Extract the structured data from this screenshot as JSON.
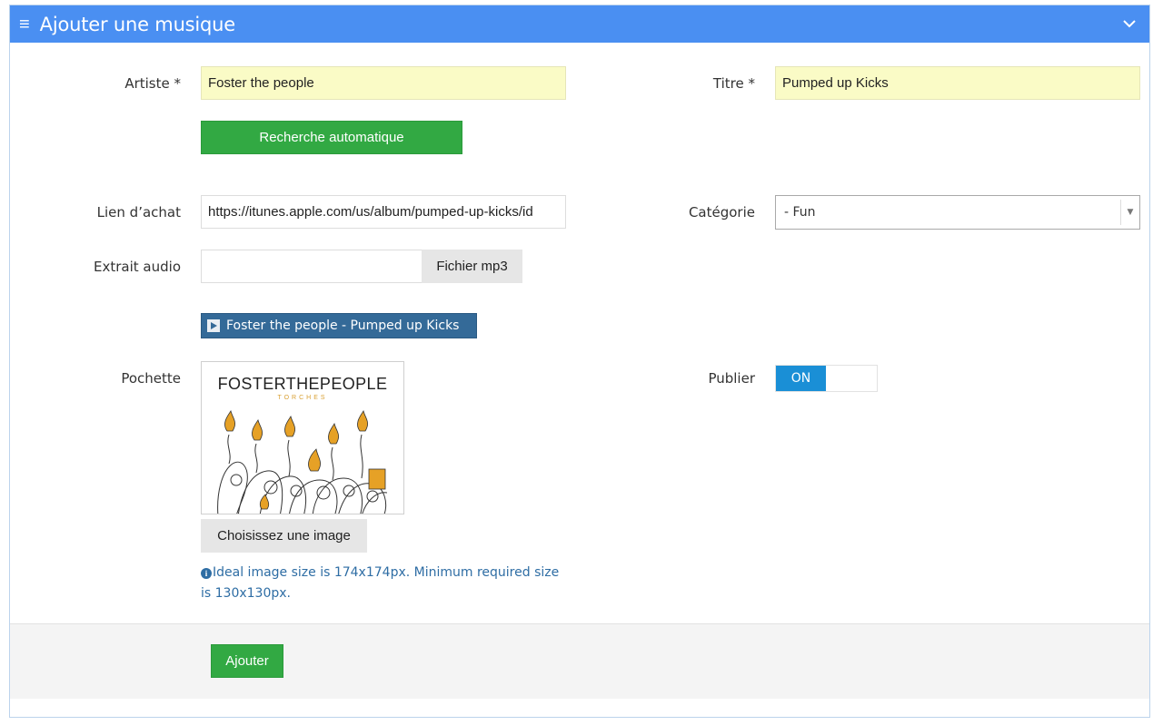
{
  "header": {
    "title": "Ajouter une musique",
    "menu_glyph": "≡"
  },
  "form": {
    "artist": {
      "label": "Artiste *",
      "value": "Foster the people"
    },
    "title": {
      "label": "Titre *",
      "value": "Pumped up Kicks"
    },
    "auto_search": {
      "label": "Recherche automatique"
    },
    "purchase_link": {
      "label": "Lien d’achat",
      "value": "https://itunes.apple.com/us/album/pumped-up-kicks/id"
    },
    "category": {
      "label": "Catégorie",
      "selected": "- Fun"
    },
    "audio": {
      "label": "Extrait audio",
      "value": "",
      "button": "Fichier mp3",
      "track": "Foster the people - Pumped up Kicks"
    },
    "cover": {
      "label": "Pochette",
      "band_text": "FOSTERTHEPEOPLE",
      "album_text": "TORCHES",
      "button": "Choisissez une image",
      "help": "Ideal image size is 174x174px. Minimum required size is 130x130px."
    },
    "publish": {
      "label": "Publier",
      "state": "ON"
    }
  },
  "footer": {
    "submit": "Ajouter"
  },
  "colors": {
    "header": "#4a8ff2",
    "green": "#32a943",
    "required_bg": "#fafbc6",
    "toggle_on": "#1a8fd6",
    "audio_chip": "#346a98"
  },
  "icons": {
    "menu": "hamburger-icon",
    "collapse": "chevron-down-icon",
    "play": "play-icon",
    "info": "info-icon",
    "select_arrow": "caret-down-icon"
  }
}
